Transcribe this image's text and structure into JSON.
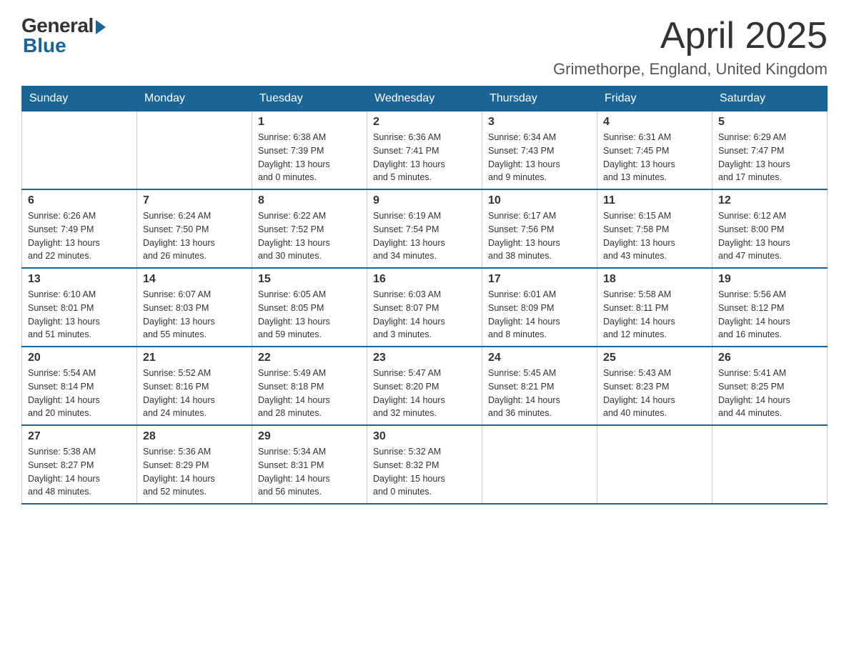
{
  "logo": {
    "general": "General",
    "blue": "Blue"
  },
  "title": "April 2025",
  "subtitle": "Grimethorpe, England, United Kingdom",
  "headers": [
    "Sunday",
    "Monday",
    "Tuesday",
    "Wednesday",
    "Thursday",
    "Friday",
    "Saturday"
  ],
  "weeks": [
    [
      {
        "day": "",
        "info": ""
      },
      {
        "day": "",
        "info": ""
      },
      {
        "day": "1",
        "info": "Sunrise: 6:38 AM\nSunset: 7:39 PM\nDaylight: 13 hours\nand 0 minutes."
      },
      {
        "day": "2",
        "info": "Sunrise: 6:36 AM\nSunset: 7:41 PM\nDaylight: 13 hours\nand 5 minutes."
      },
      {
        "day": "3",
        "info": "Sunrise: 6:34 AM\nSunset: 7:43 PM\nDaylight: 13 hours\nand 9 minutes."
      },
      {
        "day": "4",
        "info": "Sunrise: 6:31 AM\nSunset: 7:45 PM\nDaylight: 13 hours\nand 13 minutes."
      },
      {
        "day": "5",
        "info": "Sunrise: 6:29 AM\nSunset: 7:47 PM\nDaylight: 13 hours\nand 17 minutes."
      }
    ],
    [
      {
        "day": "6",
        "info": "Sunrise: 6:26 AM\nSunset: 7:49 PM\nDaylight: 13 hours\nand 22 minutes."
      },
      {
        "day": "7",
        "info": "Sunrise: 6:24 AM\nSunset: 7:50 PM\nDaylight: 13 hours\nand 26 minutes."
      },
      {
        "day": "8",
        "info": "Sunrise: 6:22 AM\nSunset: 7:52 PM\nDaylight: 13 hours\nand 30 minutes."
      },
      {
        "day": "9",
        "info": "Sunrise: 6:19 AM\nSunset: 7:54 PM\nDaylight: 13 hours\nand 34 minutes."
      },
      {
        "day": "10",
        "info": "Sunrise: 6:17 AM\nSunset: 7:56 PM\nDaylight: 13 hours\nand 38 minutes."
      },
      {
        "day": "11",
        "info": "Sunrise: 6:15 AM\nSunset: 7:58 PM\nDaylight: 13 hours\nand 43 minutes."
      },
      {
        "day": "12",
        "info": "Sunrise: 6:12 AM\nSunset: 8:00 PM\nDaylight: 13 hours\nand 47 minutes."
      }
    ],
    [
      {
        "day": "13",
        "info": "Sunrise: 6:10 AM\nSunset: 8:01 PM\nDaylight: 13 hours\nand 51 minutes."
      },
      {
        "day": "14",
        "info": "Sunrise: 6:07 AM\nSunset: 8:03 PM\nDaylight: 13 hours\nand 55 minutes."
      },
      {
        "day": "15",
        "info": "Sunrise: 6:05 AM\nSunset: 8:05 PM\nDaylight: 13 hours\nand 59 minutes."
      },
      {
        "day": "16",
        "info": "Sunrise: 6:03 AM\nSunset: 8:07 PM\nDaylight: 14 hours\nand 3 minutes."
      },
      {
        "day": "17",
        "info": "Sunrise: 6:01 AM\nSunset: 8:09 PM\nDaylight: 14 hours\nand 8 minutes."
      },
      {
        "day": "18",
        "info": "Sunrise: 5:58 AM\nSunset: 8:11 PM\nDaylight: 14 hours\nand 12 minutes."
      },
      {
        "day": "19",
        "info": "Sunrise: 5:56 AM\nSunset: 8:12 PM\nDaylight: 14 hours\nand 16 minutes."
      }
    ],
    [
      {
        "day": "20",
        "info": "Sunrise: 5:54 AM\nSunset: 8:14 PM\nDaylight: 14 hours\nand 20 minutes."
      },
      {
        "day": "21",
        "info": "Sunrise: 5:52 AM\nSunset: 8:16 PM\nDaylight: 14 hours\nand 24 minutes."
      },
      {
        "day": "22",
        "info": "Sunrise: 5:49 AM\nSunset: 8:18 PM\nDaylight: 14 hours\nand 28 minutes."
      },
      {
        "day": "23",
        "info": "Sunrise: 5:47 AM\nSunset: 8:20 PM\nDaylight: 14 hours\nand 32 minutes."
      },
      {
        "day": "24",
        "info": "Sunrise: 5:45 AM\nSunset: 8:21 PM\nDaylight: 14 hours\nand 36 minutes."
      },
      {
        "day": "25",
        "info": "Sunrise: 5:43 AM\nSunset: 8:23 PM\nDaylight: 14 hours\nand 40 minutes."
      },
      {
        "day": "26",
        "info": "Sunrise: 5:41 AM\nSunset: 8:25 PM\nDaylight: 14 hours\nand 44 minutes."
      }
    ],
    [
      {
        "day": "27",
        "info": "Sunrise: 5:38 AM\nSunset: 8:27 PM\nDaylight: 14 hours\nand 48 minutes."
      },
      {
        "day": "28",
        "info": "Sunrise: 5:36 AM\nSunset: 8:29 PM\nDaylight: 14 hours\nand 52 minutes."
      },
      {
        "day": "29",
        "info": "Sunrise: 5:34 AM\nSunset: 8:31 PM\nDaylight: 14 hours\nand 56 minutes."
      },
      {
        "day": "30",
        "info": "Sunrise: 5:32 AM\nSunset: 8:32 PM\nDaylight: 15 hours\nand 0 minutes."
      },
      {
        "day": "",
        "info": ""
      },
      {
        "day": "",
        "info": ""
      },
      {
        "day": "",
        "info": ""
      }
    ]
  ]
}
